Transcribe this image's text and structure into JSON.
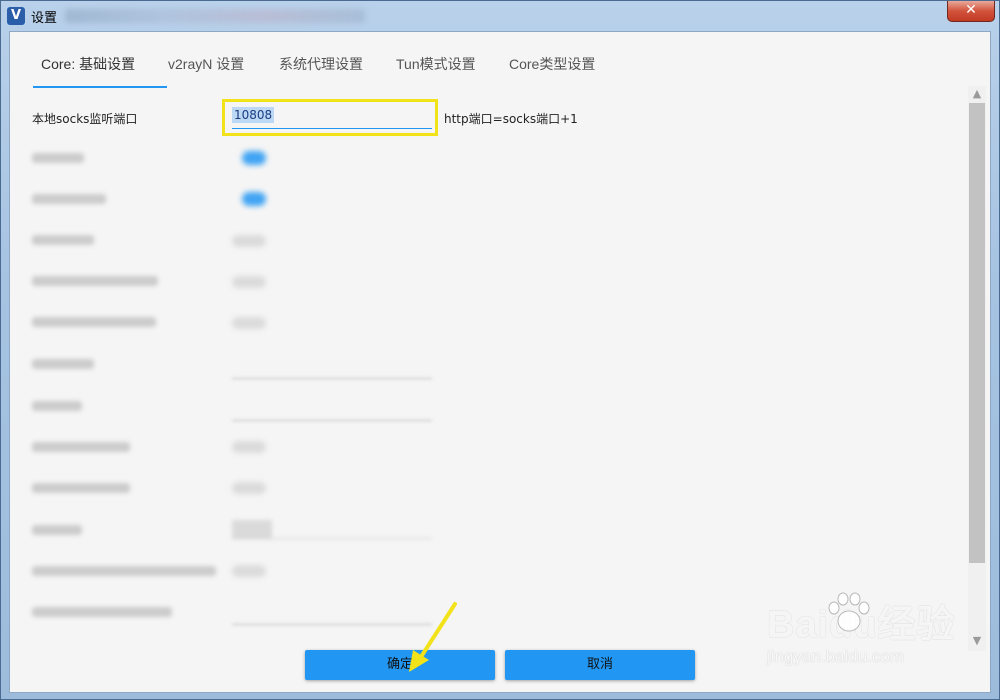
{
  "window": {
    "title": "设置",
    "close_label": "✕"
  },
  "tabs": [
    {
      "label": "Core: 基础设置",
      "active": true
    },
    {
      "label": "v2rayN 设置",
      "active": false
    },
    {
      "label": "系统代理设置",
      "active": false
    },
    {
      "label": "Tun模式设置",
      "active": false
    },
    {
      "label": "Core类型设置",
      "active": false
    }
  ],
  "settings": {
    "socks_port": {
      "label": "本地socks监听端口",
      "value": "10808",
      "hint": "http端口=socks端口+1"
    }
  },
  "buttons": {
    "ok": "确定",
    "cancel": "取消"
  },
  "watermark": {
    "brand": "Baidu经验",
    "url": "jingyan.baidu.com"
  },
  "colors": {
    "accent": "#2196f3",
    "highlight": "#f2e21a"
  }
}
